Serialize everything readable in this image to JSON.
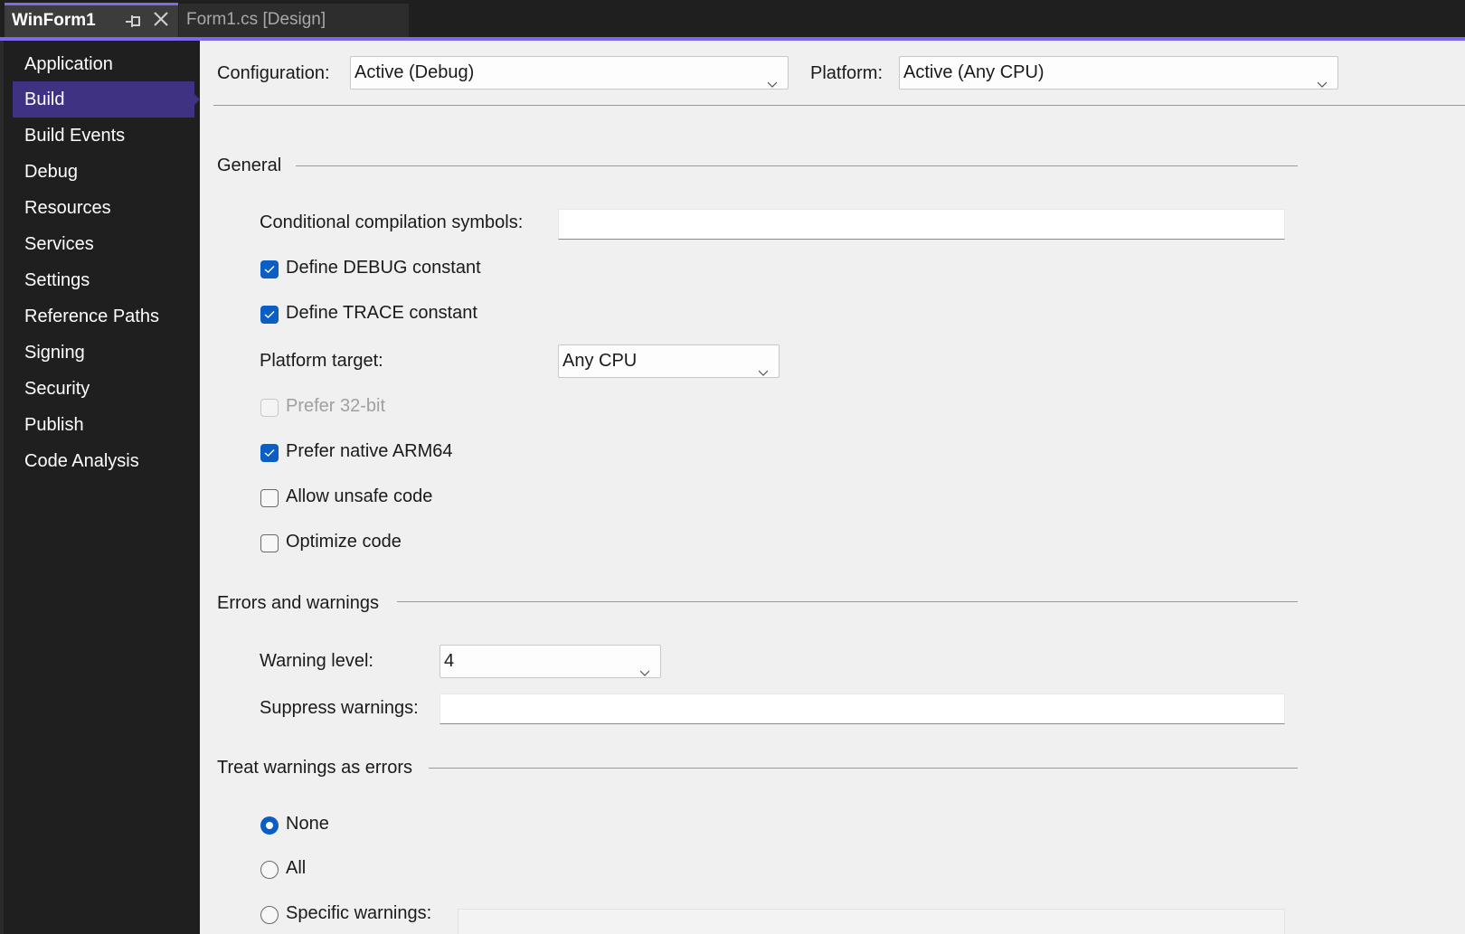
{
  "tabs": [
    {
      "label": "WinForm1",
      "active": true,
      "pin_icon": "pin-icon",
      "close_icon": "close-icon"
    },
    {
      "label": "Form1.cs [Design]",
      "active": false
    }
  ],
  "colors": {
    "accent": "#7b68ee",
    "sidebar_selected": "#3f3282",
    "checkbox_checked": "#0a5ec4"
  },
  "sidebar": {
    "selected": "Build",
    "items": [
      {
        "label": "Application"
      },
      {
        "label": "Build"
      },
      {
        "label": "Build Events"
      },
      {
        "label": "Debug"
      },
      {
        "label": "Resources"
      },
      {
        "label": "Services"
      },
      {
        "label": "Settings"
      },
      {
        "label": "Reference Paths"
      },
      {
        "label": "Signing"
      },
      {
        "label": "Security"
      },
      {
        "label": "Publish"
      },
      {
        "label": "Code Analysis"
      }
    ]
  },
  "header": {
    "configuration_label": "Configuration:",
    "configuration_value": "Active (Debug)",
    "platform_label": "Platform:",
    "platform_value": "Active (Any CPU)"
  },
  "general": {
    "title": "General",
    "conditional_symbols_label": "Conditional compilation symbols:",
    "conditional_symbols_value": "",
    "define_debug": {
      "label": "Define DEBUG constant",
      "checked": true
    },
    "define_trace": {
      "label": "Define TRACE constant",
      "checked": true
    },
    "platform_target_label": "Platform target:",
    "platform_target_value": "Any CPU",
    "prefer_32bit": {
      "label": "Prefer 32-bit",
      "checked": false,
      "enabled": false
    },
    "prefer_arm64": {
      "label": "Prefer native ARM64",
      "checked": true
    },
    "allow_unsafe": {
      "label": "Allow unsafe code",
      "checked": false
    },
    "optimize": {
      "label": "Optimize code",
      "checked": false
    }
  },
  "errors_warnings": {
    "title": "Errors and warnings",
    "warning_level_label": "Warning level:",
    "warning_level_value": "4",
    "suppress_label": "Suppress warnings:",
    "suppress_value": ""
  },
  "treat_warnings": {
    "title": "Treat warnings as errors",
    "selected": "None",
    "options": [
      {
        "label": "None",
        "selected": true
      },
      {
        "label": "All",
        "selected": false
      },
      {
        "label": "Specific warnings:",
        "selected": false
      }
    ],
    "specific_value": ""
  }
}
